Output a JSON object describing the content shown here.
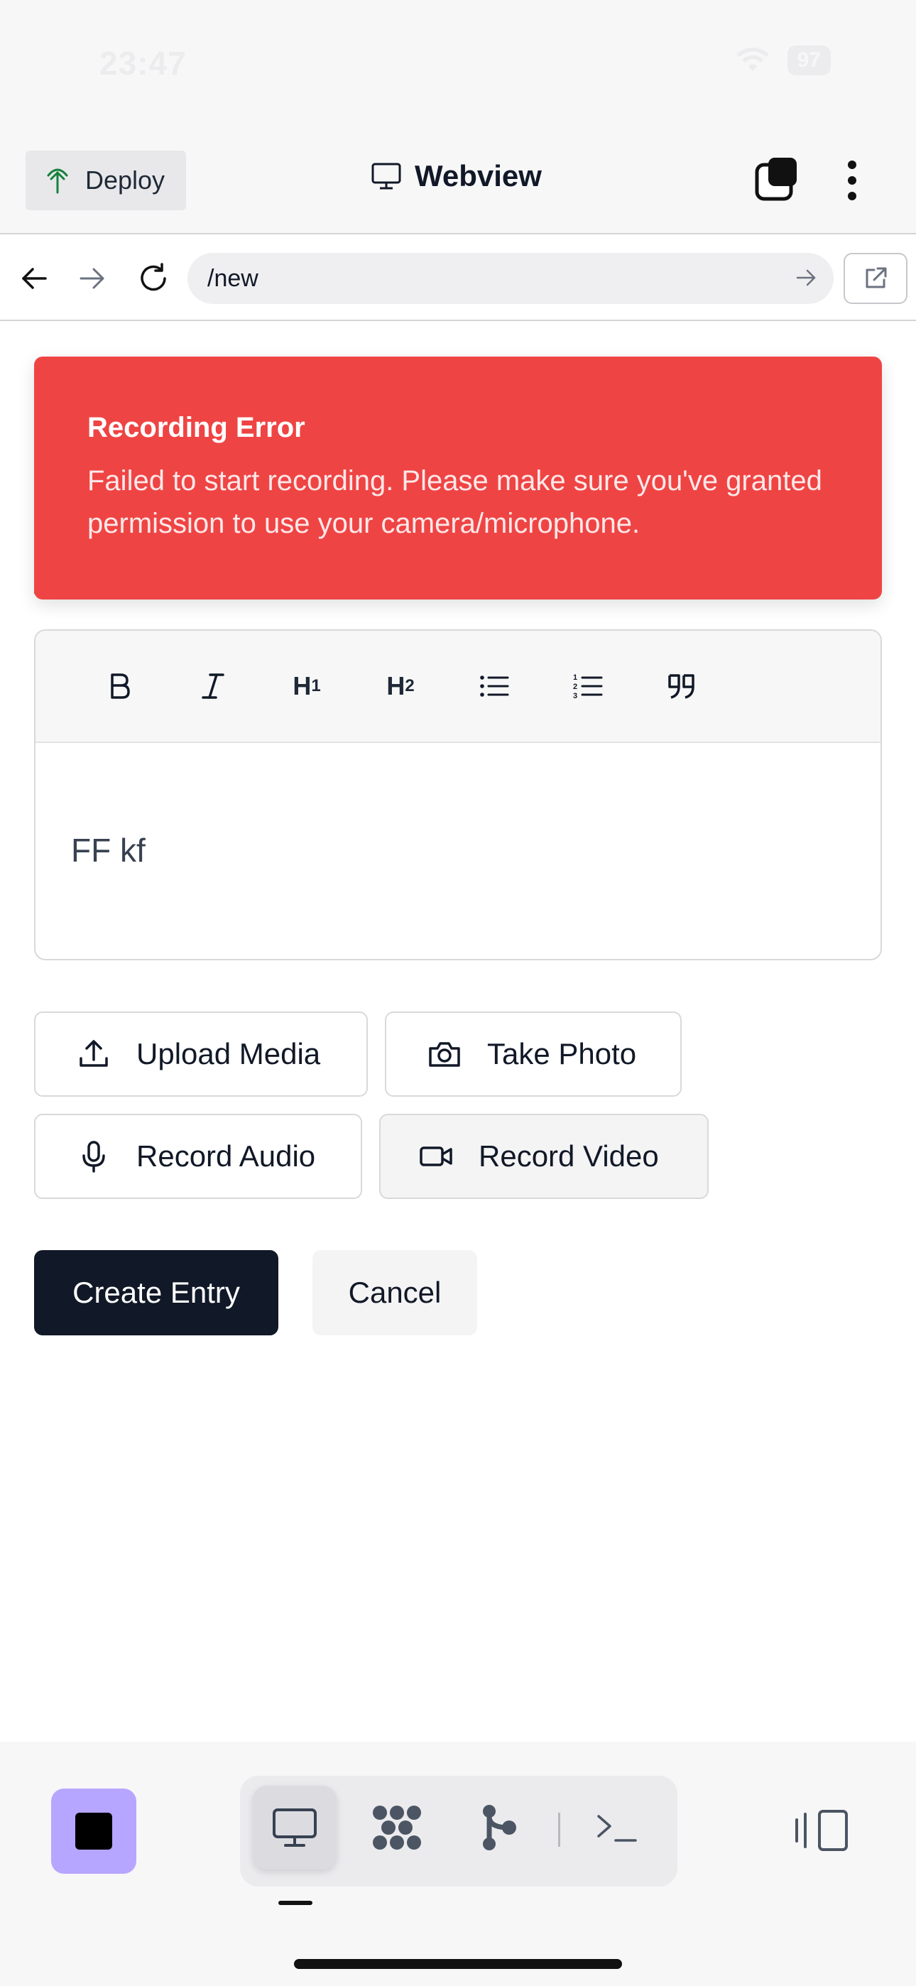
{
  "status_bar": {
    "time": "23:47",
    "battery": "97"
  },
  "header": {
    "deploy_label": "Deploy",
    "title": "Webview"
  },
  "urlbar": {
    "url": "/new"
  },
  "toast": {
    "title": "Recording Error",
    "message": "Failed to start recording. Please make sure you've granted permission to use your camera/microphone.",
    "background": "#ef4444"
  },
  "editor": {
    "toolbar": {
      "bold": "B",
      "italic": "I",
      "h1": "H",
      "h1_sub": "1",
      "h2": "H",
      "h2_sub": "2"
    },
    "content": "FF kf"
  },
  "media_buttons": {
    "upload": "Upload Media",
    "photo": "Take Photo",
    "audio": "Record Audio",
    "video": "Record Video"
  },
  "actions": {
    "create": "Create Entry",
    "cancel": "Cancel"
  },
  "dock": {
    "stop_color": "#b7a6ff",
    "tabs": [
      "monitor-icon",
      "grid-dots-icon",
      "git-branch-icon",
      "terminal-icon"
    ]
  }
}
